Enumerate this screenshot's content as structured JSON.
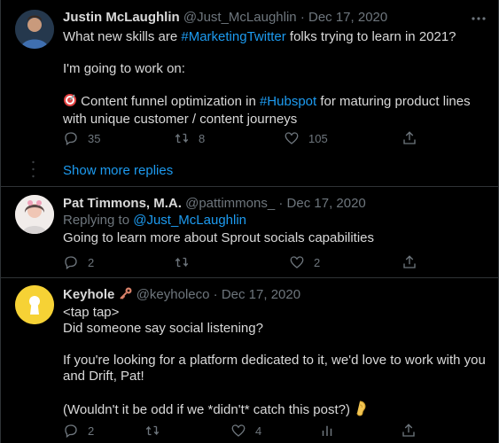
{
  "tweets": [
    {
      "name": "Justin McLaughlin",
      "handle": "@Just_McLaughlin",
      "sep": "·",
      "date": "Dec 17, 2020",
      "line1_pre": "What new skills are ",
      "line1_tag": "#MarketingTwitter",
      "line1_post": " folks trying to learn in 2021?",
      "line2": "I'm going to work on:",
      "line3_pre": " Content funnel optimization in ",
      "line3_tag": "#Hubspot",
      "line3_post": " for maturing product lines",
      "line4": "with unique customer / content journeys",
      "replies": "35",
      "retweets": "8",
      "likes": "105"
    },
    {
      "name": "Pat Timmons, M.A.",
      "handle": "@pattimmons_",
      "sep": "·",
      "date": "Dec 17, 2020",
      "replying_pre": "Replying to ",
      "replying_handle": "@Just_McLaughlin",
      "line1": "Going to learn more about Sprout socials capabilities",
      "replies": "2",
      "retweets": "",
      "likes": "2"
    },
    {
      "name": "Keyhole",
      "handle": "@keyholeco",
      "sep": "·",
      "date": "Dec 17, 2020",
      "line1": "<tap tap>",
      "line2": "Did someone say social listening?",
      "line3": "If you're looking for a platform dedicated to it, we'd love to work with you",
      "line4": "and Drift, Pat!",
      "line5": "(Wouldn't it be odd if we *didn't* catch this post?)",
      "replies": "2",
      "retweets": "",
      "likes": "4"
    }
  ],
  "show_more": "Show more replies",
  "colors": {
    "background": "#000000",
    "link": "#1d9bf0",
    "muted": "#6e767d",
    "text": "#d9d9d9"
  }
}
